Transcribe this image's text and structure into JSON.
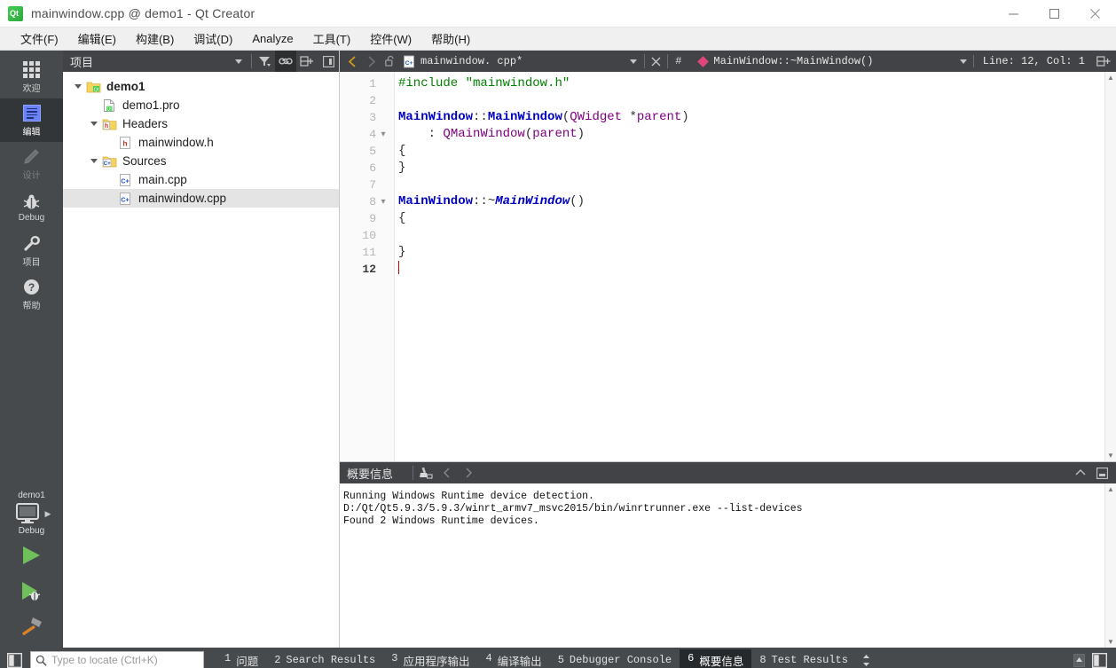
{
  "window": {
    "title": "mainwindow.cpp @ demo1 - Qt Creator",
    "logo_icon": "qt-logo-icon",
    "minimize_icon": "minimize-icon",
    "maximize_icon": "maximize-icon",
    "close_icon": "close-icon"
  },
  "menubar": {
    "items": [
      {
        "label": "文件(F)"
      },
      {
        "label": "编辑(E)"
      },
      {
        "label": "构建(B)"
      },
      {
        "label": "调试(D)"
      },
      {
        "label": "Analyze"
      },
      {
        "label": "工具(T)"
      },
      {
        "label": "控件(W)"
      },
      {
        "label": "帮助(H)"
      }
    ]
  },
  "modebar": {
    "modes": [
      {
        "label": "欢迎",
        "icon": "grid-welcome-icon",
        "state": "normal"
      },
      {
        "label": "编辑",
        "icon": "document-edit-icon",
        "state": "selected"
      },
      {
        "label": "设计",
        "icon": "pencil-design-icon",
        "state": "disabled"
      },
      {
        "label": "Debug",
        "icon": "bug-debug-icon",
        "state": "normal"
      },
      {
        "label": "项目",
        "icon": "wrench-projects-icon",
        "state": "normal"
      },
      {
        "label": "帮助",
        "icon": "question-help-icon",
        "state": "normal"
      }
    ],
    "kit_selector": {
      "project": "demo1",
      "build_config": "Debug",
      "icon": "monitor-kit-icon",
      "arrow_icon": "chevron-right-icon"
    },
    "actions": [
      {
        "name": "run-button",
        "icon": "play-run-icon"
      },
      {
        "name": "debug-button",
        "icon": "play-bug-debug-icon"
      },
      {
        "name": "build-button",
        "icon": "hammer-build-icon"
      }
    ]
  },
  "project_pane": {
    "title": "项目",
    "toolbar": [
      {
        "name": "view-dropdown",
        "icon": "chevron-down-icon"
      },
      {
        "name": "filter-button",
        "icon": "filter-icon"
      },
      {
        "name": "link-with-editor-button",
        "icon": "link-icon",
        "active": true
      },
      {
        "name": "collapse-all-button",
        "icon": "collapse-all-icon"
      },
      {
        "name": "close-pane-button",
        "icon": "close-pane-icon"
      }
    ],
    "tree": [
      {
        "label": "demo1",
        "indent": 0,
        "twisty": "expanded",
        "icon": "qt-project-icon",
        "bold": true,
        "selected": false
      },
      {
        "label": "demo1.pro",
        "indent": 1,
        "twisty": "none",
        "icon": "qt-pro-file-icon",
        "bold": false,
        "selected": false
      },
      {
        "label": "Headers",
        "indent": 1,
        "twisty": "expanded",
        "icon": "headers-folder-icon",
        "bold": false,
        "selected": false
      },
      {
        "label": "mainwindow.h",
        "indent": 2,
        "twisty": "none",
        "icon": "h-file-icon",
        "bold": false,
        "selected": false
      },
      {
        "label": "Sources",
        "indent": 1,
        "twisty": "expanded",
        "icon": "sources-folder-icon",
        "bold": false,
        "selected": false
      },
      {
        "label": "main.cpp",
        "indent": 2,
        "twisty": "none",
        "icon": "cpp-file-icon",
        "bold": false,
        "selected": false
      },
      {
        "label": "mainwindow.cpp",
        "indent": 2,
        "twisty": "none",
        "icon": "cpp-file-icon",
        "bold": false,
        "selected": true
      }
    ]
  },
  "editor": {
    "toolbar": {
      "back_icon": "chevron-left-icon",
      "forward_icon": "chevron-right-icon",
      "lock_icon": "unlocked-padlock-icon",
      "file_icon": "cpp-file-icon",
      "filename": "mainwindow. cpp*",
      "dropdown_icon": "chevron-down-icon",
      "close_icon": "close-icon",
      "hash_label": "#",
      "symbol_icon": "pink-diamond-icon",
      "symbol": "MainWindow::~MainWindow()",
      "symbol_dropdown_icon": "chevron-down-icon",
      "line_col": "Line: 12, Col: 1",
      "split_icon": "split-editor-icon"
    },
    "scroll_up_icon": "scroll-up-arrow-icon",
    "scroll_down_icon": "scroll-down-arrow-icon",
    "lines": [
      {
        "n": "1",
        "fold": "",
        "current": false,
        "tokens": [
          {
            "t": "#include ",
            "c": "k-pre"
          },
          {
            "t": "\"mainwindow.h\"",
            "c": "k-str"
          }
        ]
      },
      {
        "n": "2",
        "fold": "",
        "current": false,
        "tokens": []
      },
      {
        "n": "3",
        "fold": "",
        "current": false,
        "tokens": [
          {
            "t": "MainWindow",
            "c": "k-cls"
          },
          {
            "t": "::",
            "c": "k-plain"
          },
          {
            "t": "MainWindow",
            "c": "k-cls"
          },
          {
            "t": "(",
            "c": "k-plain"
          },
          {
            "t": "QWidget",
            "c": "k-var"
          },
          {
            "t": " *",
            "c": "k-plain"
          },
          {
            "t": "parent",
            "c": "k-var"
          },
          {
            "t": ")",
            "c": "k-plain"
          }
        ]
      },
      {
        "n": "4",
        "fold": "v",
        "current": false,
        "tokens": [
          {
            "t": "    : ",
            "c": "k-plain"
          },
          {
            "t": "QMainWindow",
            "c": "k-var"
          },
          {
            "t": "(",
            "c": "k-plain"
          },
          {
            "t": "parent",
            "c": "k-var"
          },
          {
            "t": ")",
            "c": "k-plain"
          }
        ]
      },
      {
        "n": "5",
        "fold": "",
        "current": false,
        "tokens": [
          {
            "t": "{",
            "c": "k-plain"
          }
        ]
      },
      {
        "n": "6",
        "fold": "",
        "current": false,
        "tokens": [
          {
            "t": "}",
            "c": "k-plain"
          }
        ]
      },
      {
        "n": "7",
        "fold": "",
        "current": false,
        "tokens": []
      },
      {
        "n": "8",
        "fold": "v",
        "current": false,
        "tokens": [
          {
            "t": "MainWindow",
            "c": "k-cls"
          },
          {
            "t": "::~",
            "c": "k-plain"
          },
          {
            "t": "MainWindow",
            "c": "k-dtor"
          },
          {
            "t": "()",
            "c": "k-plain"
          }
        ]
      },
      {
        "n": "9",
        "fold": "",
        "current": false,
        "tokens": [
          {
            "t": "{",
            "c": "k-plain"
          }
        ]
      },
      {
        "n": "10",
        "fold": "",
        "current": false,
        "tokens": []
      },
      {
        "n": "11",
        "fold": "",
        "current": false,
        "tokens": [
          {
            "t": "}",
            "c": "k-plain"
          }
        ]
      },
      {
        "n": "12",
        "fold": "",
        "current": true,
        "tokens": []
      }
    ]
  },
  "output_pane": {
    "title": "概要信息",
    "toolbar": [
      {
        "name": "clear-output-button",
        "icon": "broom-clear-icon"
      },
      {
        "name": "prev-item-button",
        "icon": "chevron-left-icon"
      },
      {
        "name": "next-item-button",
        "icon": "chevron-right-icon"
      }
    ],
    "minimize_icon": "chevron-up-icon",
    "maximize_icon": "maximize-pane-icon",
    "lines": [
      "Running Windows Runtime device detection.",
      "D:/Qt/Qt5.9.3/5.9.3/winrt_armv7_msvc2015/bin/winrtrunner.exe --list-devices",
      "Found 2 Windows Runtime devices."
    ]
  },
  "statusbar": {
    "sidebar_toggle_icon": "sidebar-toggle-icon",
    "search": {
      "icon": "search-icon",
      "placeholder": "Type to locate (Ctrl+K)",
      "value": ""
    },
    "tabs": [
      {
        "num": "1",
        "label": "问题",
        "zh": true,
        "active": false
      },
      {
        "num": "2",
        "label": "Search Results",
        "zh": false,
        "active": false
      },
      {
        "num": "3",
        "label": "应用程序输出",
        "zh": true,
        "active": false
      },
      {
        "num": "4",
        "label": "编译输出",
        "zh": true,
        "active": false
      },
      {
        "num": "5",
        "label": "Debugger Console",
        "zh": false,
        "active": false
      },
      {
        "num": "6",
        "label": "概要信息",
        "zh": true,
        "active": true
      },
      {
        "num": "8",
        "label": "Test Results",
        "zh": false,
        "active": false
      }
    ],
    "updown_icon": "up-down-arrows-icon",
    "right_up_icon": "scroll-up-small-icon",
    "right_panel_icon": "right-sidebar-toggle-icon"
  },
  "colors": {
    "mode_bar": "#464a4d",
    "mode_selected": "#333639",
    "header_bar": "#414346",
    "accent_green": "#41cd52",
    "symbol_pink": "#e0457b",
    "caret_red": "#cc0000",
    "selection_gray": "#e4e4e4"
  }
}
